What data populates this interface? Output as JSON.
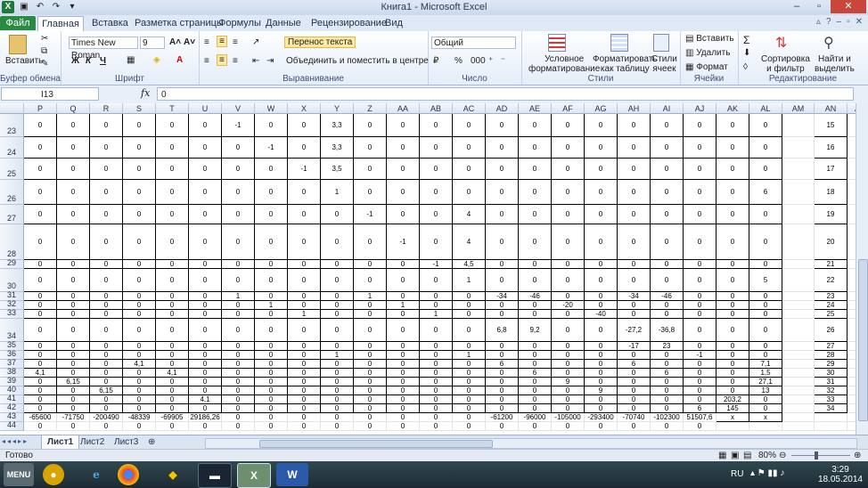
{
  "window": {
    "title": "Книга1  -  Microsoft Excel"
  },
  "tabs": {
    "file": "Файл",
    "items": [
      "Главная",
      "Вставка",
      "Разметка страницы",
      "Формулы",
      "Данные",
      "Рецензирование",
      "Вид"
    ]
  },
  "ribbon": {
    "paste": "Вставить",
    "font_name": "Times New Roman",
    "font_size": "9",
    "wrap_text": "Перенос текста",
    "merge_center": "Объединить и поместить в центре",
    "number_format": "Общий",
    "cond_format": [
      "Условное",
      "форматирование"
    ],
    "format_table": [
      "Форматировать",
      "как таблицу"
    ],
    "cell_styles": [
      "Стили",
      "ячеек"
    ],
    "insert": "Вставить",
    "delete": "Удалить",
    "format": "Формат",
    "sort": [
      "Сортировка",
      "и фильтр"
    ],
    "find": [
      "Найти и",
      "выделить"
    ],
    "groups": [
      "Буфер обмена",
      "Шрифт",
      "Выравнивание",
      "Число",
      "Стили",
      "Ячейки",
      "Редактирование"
    ]
  },
  "formula_bar": {
    "name_box": "I13",
    "fx": "fx",
    "value": "0"
  },
  "columns": [
    "P",
    "Q",
    "R",
    "S",
    "T",
    "U",
    "V",
    "W",
    "X",
    "Y",
    "Z",
    "AA",
    "AB",
    "AC",
    "AD",
    "AE",
    "AF",
    "AG",
    "AH",
    "AI",
    "AJ",
    "AK",
    "AL",
    "AM",
    "AN",
    "AO"
  ],
  "rows": [
    {
      "num": "23",
      "h": 26,
      "cells": [
        "0",
        "0",
        "0",
        "0",
        "0",
        "0",
        "-1",
        "0",
        "0",
        "3,3",
        "0",
        "0",
        "0",
        "0",
        "0",
        "0",
        "0",
        "0",
        "0",
        "0",
        "0",
        "0",
        "0",
        "",
        "15",
        ""
      ]
    },
    {
      "num": "24",
      "h": 24,
      "cells": [
        "0",
        "0",
        "0",
        "0",
        "0",
        "0",
        "0",
        "-1",
        "0",
        "3,3",
        "0",
        "0",
        "0",
        "0",
        "0",
        "0",
        "0",
        "0",
        "0",
        "0",
        "0",
        "0",
        "0",
        "",
        "16",
        ""
      ]
    },
    {
      "num": "25",
      "h": 24,
      "cells": [
        "0",
        "0",
        "0",
        "0",
        "0",
        "0",
        "0",
        "0",
        "-1",
        "3,5",
        "0",
        "0",
        "0",
        "0",
        "0",
        "0",
        "0",
        "0",
        "0",
        "0",
        "0",
        "0",
        "0",
        "",
        "17",
        ""
      ]
    },
    {
      "num": "26",
      "h": 28,
      "cells": [
        "0",
        "0",
        "0",
        "0",
        "0",
        "0",
        "0",
        "0",
        "0",
        "1",
        "0",
        "0",
        "0",
        "0",
        "0",
        "0",
        "0",
        "0",
        "0",
        "0",
        "0",
        "0",
        "6",
        "",
        "18",
        ""
      ]
    },
    {
      "num": "27",
      "h": 22,
      "cells": [
        "0",
        "0",
        "0",
        "0",
        "0",
        "0",
        "0",
        "0",
        "0",
        "0",
        "-1",
        "0",
        "0",
        "4",
        "0",
        "0",
        "0",
        "0",
        "0",
        "0",
        "0",
        "0",
        "0",
        "",
        "19",
        ""
      ]
    },
    {
      "num": "28",
      "h": 40,
      "cells": [
        "0",
        "0",
        "0",
        "0",
        "0",
        "0",
        "0",
        "0",
        "0",
        "0",
        "0",
        "-1",
        "0",
        "4",
        "0",
        "0",
        "0",
        "0",
        "0",
        "0",
        "0",
        "0",
        "0",
        "",
        "20",
        ""
      ]
    },
    {
      "num": "29",
      "h": 10,
      "cells": [
        "0",
        "0",
        "0",
        "0",
        "0",
        "0",
        "0",
        "0",
        "0",
        "0",
        "0",
        "0",
        "-1",
        "4,5",
        "0",
        "0",
        "0",
        "0",
        "0",
        "0",
        "0",
        "0",
        "0",
        "",
        "21",
        ""
      ]
    },
    {
      "num": "30",
      "h": 26,
      "cells": [
        "0",
        "0",
        "0",
        "0",
        "0",
        "0",
        "0",
        "0",
        "0",
        "0",
        "0",
        "0",
        "0",
        "1",
        "0",
        "0",
        "0",
        "0",
        "0",
        "0",
        "0",
        "0",
        "5",
        "",
        "22",
        ""
      ]
    },
    {
      "num": "31",
      "h": 10,
      "cells": [
        "0",
        "0",
        "0",
        "0",
        "0",
        "0",
        "1",
        "0",
        "0",
        "0",
        "1",
        "0",
        "0",
        "0",
        "-34",
        "-46",
        "0",
        "0",
        "-34",
        "-46",
        "0",
        "0",
        "0",
        "",
        "23",
        ""
      ]
    },
    {
      "num": "32",
      "h": 10,
      "cells": [
        "0",
        "0",
        "0",
        "0",
        "0",
        "0",
        "0",
        "1",
        "0",
        "0",
        "0",
        "1",
        "0",
        "0",
        "0",
        "0",
        "-20",
        "0",
        "0",
        "0",
        "0",
        "0",
        "0",
        "",
        "24",
        ""
      ]
    },
    {
      "num": "33",
      "h": 10,
      "cells": [
        "0",
        "0",
        "0",
        "0",
        "0",
        "0",
        "0",
        "0",
        "1",
        "0",
        "0",
        "0",
        "1",
        "0",
        "0",
        "0",
        "0",
        "-40",
        "0",
        "0",
        "0",
        "0",
        "0",
        "",
        "25",
        ""
      ]
    },
    {
      "num": "34",
      "h": 26,
      "cells": [
        "0",
        "0",
        "0",
        "0",
        "0",
        "0",
        "0",
        "0",
        "0",
        "0",
        "0",
        "0",
        "0",
        "0",
        "6,8",
        "9,2",
        "0",
        "0",
        "-27,2",
        "-36,8",
        "0",
        "0",
        "0",
        "",
        "26",
        ""
      ]
    },
    {
      "num": "35",
      "h": 10,
      "cells": [
        "0",
        "0",
        "0",
        "0",
        "0",
        "0",
        "0",
        "0",
        "0",
        "0",
        "0",
        "0",
        "0",
        "0",
        "0",
        "0",
        "0",
        "0",
        "-17",
        "23",
        "0",
        "0",
        "0",
        "",
        "27",
        ""
      ]
    },
    {
      "num": "36",
      "h": 10,
      "cells": [
        "0",
        "0",
        "0",
        "0",
        "0",
        "0",
        "0",
        "0",
        "0",
        "1",
        "0",
        "0",
        "0",
        "1",
        "0",
        "0",
        "0",
        "0",
        "0",
        "0",
        "-1",
        "0",
        "0",
        "",
        "28",
        ""
      ]
    },
    {
      "num": "37",
      "h": 10,
      "cells": [
        "0",
        "0",
        "0",
        "4,1",
        "0",
        "0",
        "0",
        "0",
        "0",
        "0",
        "0",
        "0",
        "0",
        "0",
        "6",
        "0",
        "0",
        "0",
        "6",
        "0",
        "0",
        "0",
        "7,1",
        "",
        "29",
        ""
      ]
    },
    {
      "num": "38",
      "h": 10,
      "cells": [
        "4,1",
        "0",
        "0",
        "0",
        "4,1",
        "0",
        "0",
        "0",
        "0",
        "0",
        "0",
        "0",
        "0",
        "0",
        "0",
        "6",
        "0",
        "0",
        "0",
        "6",
        "0",
        "0",
        "1,5",
        "",
        "30",
        ""
      ]
    },
    {
      "num": "39",
      "h": 10,
      "cells": [
        "0",
        "6,15",
        "0",
        "0",
        "0",
        "0",
        "0",
        "0",
        "0",
        "0",
        "0",
        "0",
        "0",
        "0",
        "0",
        "0",
        "9",
        "0",
        "0",
        "0",
        "0",
        "0",
        "27,1",
        "",
        "31",
        ""
      ]
    },
    {
      "num": "40",
      "h": 10,
      "cells": [
        "0",
        "0",
        "6,15",
        "0",
        "0",
        "0",
        "0",
        "0",
        "0",
        "0",
        "0",
        "0",
        "0",
        "0",
        "0",
        "0",
        "0",
        "9",
        "0",
        "0",
        "0",
        "0",
        "13",
        "",
        "32",
        ""
      ]
    },
    {
      "num": "41",
      "h": 10,
      "cells": [
        "0",
        "0",
        "0",
        "0",
        "0",
        "4,1",
        "0",
        "0",
        "0",
        "0",
        "0",
        "0",
        "0",
        "0",
        "0",
        "0",
        "0",
        "0",
        "0",
        "0",
        "0",
        "203,2",
        "0",
        "",
        "33",
        ""
      ]
    },
    {
      "num": "42",
      "h": 10,
      "cells": [
        "0",
        "0",
        "0",
        "0",
        "0",
        "0",
        "0",
        "0",
        "0",
        "0",
        "0",
        "0",
        "0",
        "0",
        "0",
        "0",
        "0",
        "0",
        "0",
        "0",
        "6",
        "145",
        "0",
        "",
        "34",
        ""
      ]
    },
    {
      "num": "43",
      "h": 10,
      "cells": [
        "-65600",
        "-71750",
        "-200490",
        "-48339",
        "-69905",
        "29186,26",
        "0",
        "0",
        "0",
        "0",
        "0",
        "0",
        "0",
        "0",
        "-61200",
        "-96000",
        "-105000",
        "-293400",
        "-70740",
        "-102300",
        "51507,6",
        "x",
        "x",
        "",
        "",
        ""
      ]
    },
    {
      "num": "44",
      "h": 10,
      "cells": [
        "0",
        "0",
        "0",
        "0",
        "0",
        "0",
        "0",
        "0",
        "0",
        "0",
        "0",
        "0",
        "0",
        "0",
        "0",
        "0",
        "0",
        "0",
        "0",
        "0",
        "0",
        "",
        "",
        "",
        "",
        ""
      ]
    }
  ],
  "sheets": [
    "Лист1",
    "Лист2",
    "Лист3"
  ],
  "status": {
    "ready": "Готово",
    "zoom": "80%"
  },
  "taskbar": {
    "start": "MENU",
    "lang": "RU",
    "time": "3:29",
    "date": "18.05.2014"
  }
}
